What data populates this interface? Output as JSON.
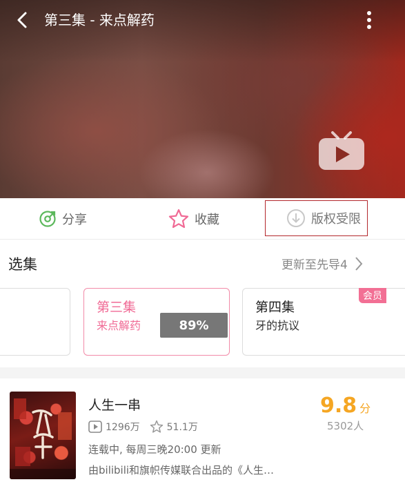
{
  "header": {
    "title": "第三集 - 来点解药"
  },
  "actions": {
    "share_label": "分享",
    "favorite_label": "收藏",
    "download_label": "版权受限"
  },
  "episodes": {
    "section_title": "选集",
    "update_text": "更新至先导4",
    "items": [
      {
        "number": "",
        "name": ""
      },
      {
        "number": "第三集",
        "name": "来点解药",
        "progress": "89%"
      },
      {
        "number": "第四集",
        "name": "牙的抗议",
        "badge": "会员"
      }
    ]
  },
  "show": {
    "title": "人生一串",
    "plays": "1296万",
    "favorites": "51.1万",
    "status": "连载中, 每周三晚20:00 更新",
    "description": "由bilibili和旗帜传媒联合出品的《人生…",
    "score": "9.8",
    "score_unit": "分",
    "rating_count": "5302人"
  },
  "colors": {
    "accent_pink": "#f06a95",
    "score_orange": "#f5a623",
    "share_green": "#5cb85c",
    "highlight_border": "#b3262b"
  },
  "icons": {
    "back": "chevron-left-icon",
    "more": "vertical-dots-icon",
    "tv": "tv-play-icon",
    "share": "share-icon",
    "favorite": "star-icon",
    "download": "download-icon",
    "chevron": "chevron-right-icon",
    "plays": "play-count-icon",
    "favorites": "star-outline-icon"
  }
}
